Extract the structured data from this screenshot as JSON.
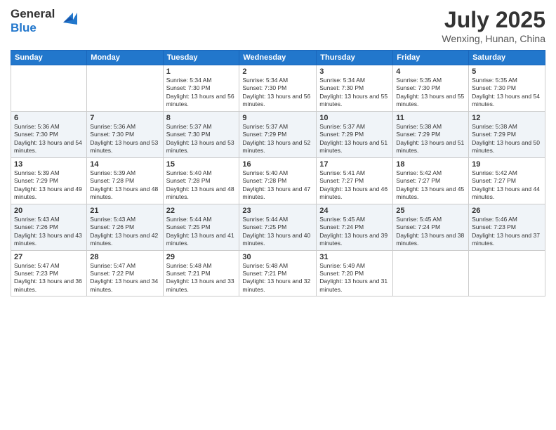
{
  "header": {
    "logo_general": "General",
    "logo_blue": "Blue",
    "month_year": "July 2025",
    "location": "Wenxing, Hunan, China"
  },
  "days_of_week": [
    "Sunday",
    "Monday",
    "Tuesday",
    "Wednesday",
    "Thursday",
    "Friday",
    "Saturday"
  ],
  "weeks": [
    [
      {
        "day": "",
        "info": ""
      },
      {
        "day": "",
        "info": ""
      },
      {
        "day": "1",
        "info": "Sunrise: 5:34 AM\nSunset: 7:30 PM\nDaylight: 13 hours and 56 minutes."
      },
      {
        "day": "2",
        "info": "Sunrise: 5:34 AM\nSunset: 7:30 PM\nDaylight: 13 hours and 56 minutes."
      },
      {
        "day": "3",
        "info": "Sunrise: 5:34 AM\nSunset: 7:30 PM\nDaylight: 13 hours and 55 minutes."
      },
      {
        "day": "4",
        "info": "Sunrise: 5:35 AM\nSunset: 7:30 PM\nDaylight: 13 hours and 55 minutes."
      },
      {
        "day": "5",
        "info": "Sunrise: 5:35 AM\nSunset: 7:30 PM\nDaylight: 13 hours and 54 minutes."
      }
    ],
    [
      {
        "day": "6",
        "info": "Sunrise: 5:36 AM\nSunset: 7:30 PM\nDaylight: 13 hours and 54 minutes."
      },
      {
        "day": "7",
        "info": "Sunrise: 5:36 AM\nSunset: 7:30 PM\nDaylight: 13 hours and 53 minutes."
      },
      {
        "day": "8",
        "info": "Sunrise: 5:37 AM\nSunset: 7:30 PM\nDaylight: 13 hours and 53 minutes."
      },
      {
        "day": "9",
        "info": "Sunrise: 5:37 AM\nSunset: 7:29 PM\nDaylight: 13 hours and 52 minutes."
      },
      {
        "day": "10",
        "info": "Sunrise: 5:37 AM\nSunset: 7:29 PM\nDaylight: 13 hours and 51 minutes."
      },
      {
        "day": "11",
        "info": "Sunrise: 5:38 AM\nSunset: 7:29 PM\nDaylight: 13 hours and 51 minutes."
      },
      {
        "day": "12",
        "info": "Sunrise: 5:38 AM\nSunset: 7:29 PM\nDaylight: 13 hours and 50 minutes."
      }
    ],
    [
      {
        "day": "13",
        "info": "Sunrise: 5:39 AM\nSunset: 7:29 PM\nDaylight: 13 hours and 49 minutes."
      },
      {
        "day": "14",
        "info": "Sunrise: 5:39 AM\nSunset: 7:28 PM\nDaylight: 13 hours and 48 minutes."
      },
      {
        "day": "15",
        "info": "Sunrise: 5:40 AM\nSunset: 7:28 PM\nDaylight: 13 hours and 48 minutes."
      },
      {
        "day": "16",
        "info": "Sunrise: 5:40 AM\nSunset: 7:28 PM\nDaylight: 13 hours and 47 minutes."
      },
      {
        "day": "17",
        "info": "Sunrise: 5:41 AM\nSunset: 7:27 PM\nDaylight: 13 hours and 46 minutes."
      },
      {
        "day": "18",
        "info": "Sunrise: 5:42 AM\nSunset: 7:27 PM\nDaylight: 13 hours and 45 minutes."
      },
      {
        "day": "19",
        "info": "Sunrise: 5:42 AM\nSunset: 7:27 PM\nDaylight: 13 hours and 44 minutes."
      }
    ],
    [
      {
        "day": "20",
        "info": "Sunrise: 5:43 AM\nSunset: 7:26 PM\nDaylight: 13 hours and 43 minutes."
      },
      {
        "day": "21",
        "info": "Sunrise: 5:43 AM\nSunset: 7:26 PM\nDaylight: 13 hours and 42 minutes."
      },
      {
        "day": "22",
        "info": "Sunrise: 5:44 AM\nSunset: 7:25 PM\nDaylight: 13 hours and 41 minutes."
      },
      {
        "day": "23",
        "info": "Sunrise: 5:44 AM\nSunset: 7:25 PM\nDaylight: 13 hours and 40 minutes."
      },
      {
        "day": "24",
        "info": "Sunrise: 5:45 AM\nSunset: 7:24 PM\nDaylight: 13 hours and 39 minutes."
      },
      {
        "day": "25",
        "info": "Sunrise: 5:45 AM\nSunset: 7:24 PM\nDaylight: 13 hours and 38 minutes."
      },
      {
        "day": "26",
        "info": "Sunrise: 5:46 AM\nSunset: 7:23 PM\nDaylight: 13 hours and 37 minutes."
      }
    ],
    [
      {
        "day": "27",
        "info": "Sunrise: 5:47 AM\nSunset: 7:23 PM\nDaylight: 13 hours and 36 minutes."
      },
      {
        "day": "28",
        "info": "Sunrise: 5:47 AM\nSunset: 7:22 PM\nDaylight: 13 hours and 34 minutes."
      },
      {
        "day": "29",
        "info": "Sunrise: 5:48 AM\nSunset: 7:21 PM\nDaylight: 13 hours and 33 minutes."
      },
      {
        "day": "30",
        "info": "Sunrise: 5:48 AM\nSunset: 7:21 PM\nDaylight: 13 hours and 32 minutes."
      },
      {
        "day": "31",
        "info": "Sunrise: 5:49 AM\nSunset: 7:20 PM\nDaylight: 13 hours and 31 minutes."
      },
      {
        "day": "",
        "info": ""
      },
      {
        "day": "",
        "info": ""
      }
    ]
  ]
}
